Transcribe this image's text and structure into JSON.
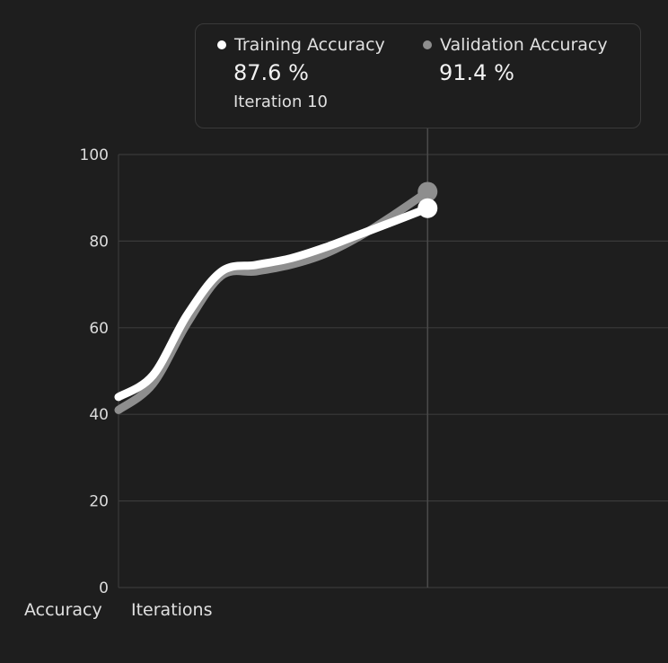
{
  "colors": {
    "background": "#1e1e1e",
    "grid": "#3a3a3a",
    "training": "#ffffff",
    "validation": "#8e8e8e"
  },
  "tooltip": {
    "training": {
      "name": "Training Accuracy",
      "value": "87.6 %",
      "iteration": "Iteration 10"
    },
    "validation": {
      "name": "Validation Accuracy",
      "value": "91.4 %"
    }
  },
  "chart_data": {
    "type": "line",
    "title": "",
    "xlabel": "Iterations",
    "ylabel": "Accuracy",
    "ylim": [
      0,
      100
    ],
    "yticks": [
      0,
      20,
      40,
      60,
      80,
      100
    ],
    "xlim": [
      1,
      17
    ],
    "grid": true,
    "cursor_iteration": 10,
    "x": [
      1,
      2,
      3,
      4,
      5,
      6,
      7,
      8,
      9,
      10
    ],
    "series": [
      {
        "name": "Validation Accuracy",
        "color": "#8e8e8e",
        "values": [
          41,
          47,
          61,
          72,
          73,
          74.5,
          77,
          81,
          86,
          91.4
        ]
      },
      {
        "name": "Training Accuracy",
        "color": "#ffffff",
        "values": [
          44,
          49,
          63,
          73,
          74.5,
          76,
          78.5,
          81.5,
          84.5,
          87.6
        ]
      }
    ]
  }
}
